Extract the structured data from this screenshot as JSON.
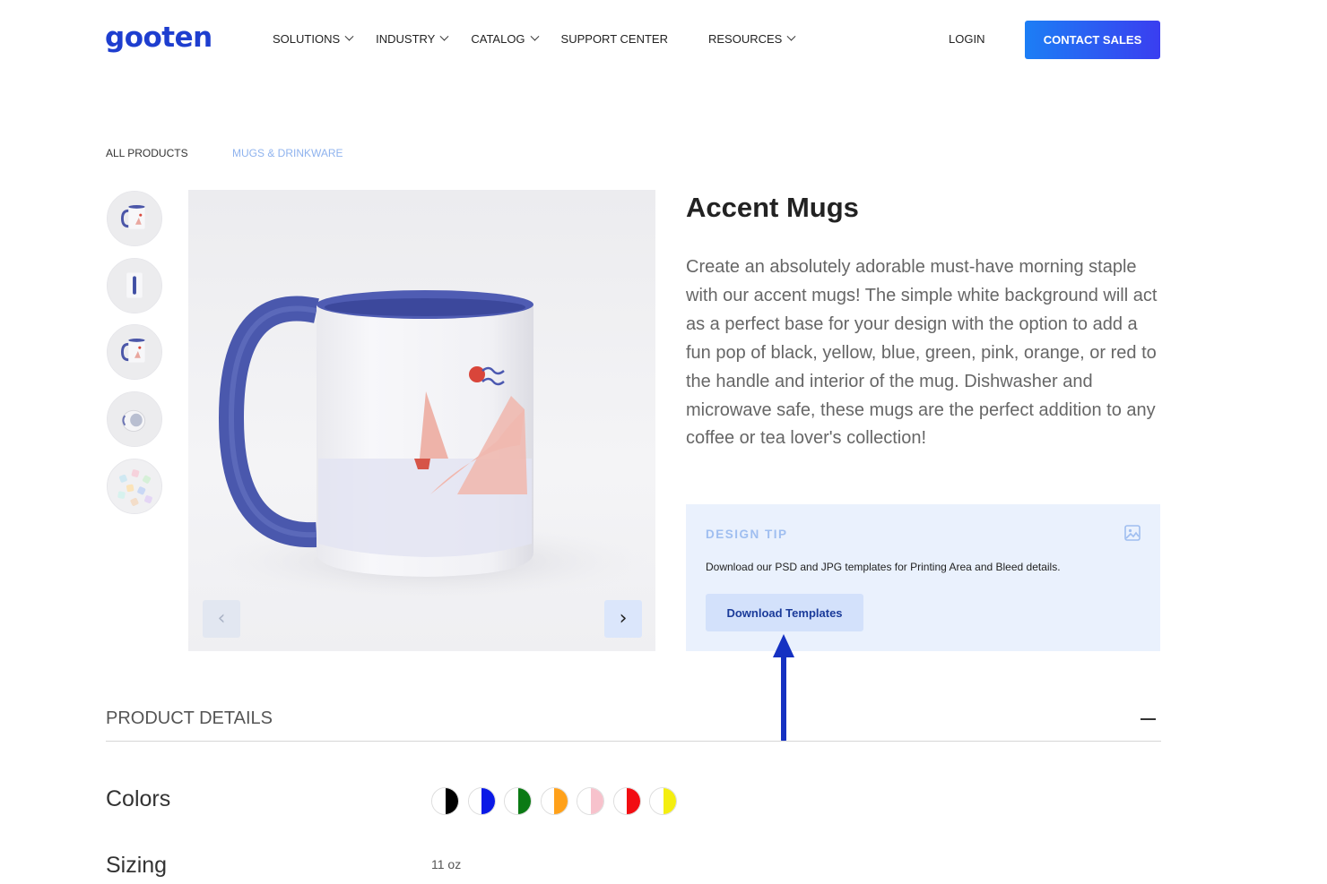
{
  "header": {
    "logo": "gooten",
    "nav": [
      {
        "label": "SOLUTIONS",
        "dropdown": true
      },
      {
        "label": "INDUSTRY",
        "dropdown": true
      },
      {
        "label": "CATALOG",
        "dropdown": true
      },
      {
        "label": "SUPPORT CENTER",
        "dropdown": false
      },
      {
        "label": "RESOURCES",
        "dropdown": true
      }
    ],
    "login": "LOGIN",
    "contact": "CONTACT SALES"
  },
  "breadcrumb": {
    "all": "ALL PRODUCTS",
    "current": "MUGS & DRINKWARE"
  },
  "gallery": {
    "thumbnails": [
      "mug-front",
      "mug-side",
      "mug-angle",
      "mug-top",
      "mug-set"
    ],
    "prev_icon": "chevron-left-icon",
    "next_icon": "chevron-right-icon"
  },
  "product": {
    "title": "Accent Mugs",
    "description": "Create an absolutely adorable must-have morning staple with our accent mugs! The simple white background will act as a perfect base for your design with the option to add a fun pop of black, yellow, blue, green, pink, orange, or red to the handle and interior of the mug. Dishwasher and microwave safe, these mugs are the perfect addition to any coffee or tea lover's collection!"
  },
  "design_tip": {
    "heading": "DESIGN TIP",
    "text": "Download our PSD and JPG templates for Printing Area and Bleed details.",
    "button": "Download Templates",
    "icon": "image-icon"
  },
  "details": {
    "heading": "PRODUCT DETAILS",
    "colors_label": "Colors",
    "colors": [
      "#000000",
      "#0a19e6",
      "#0b7a14",
      "#ffa11a",
      "#f7c2cc",
      "#f20d12",
      "#f4ee10"
    ],
    "sizing_label": "Sizing",
    "sizing_value": "11 oz"
  },
  "colors": {
    "brand_blue": "#1e3ecf",
    "annotation_arrow": "#1531c2",
    "tip_background": "#eaf1fd"
  }
}
